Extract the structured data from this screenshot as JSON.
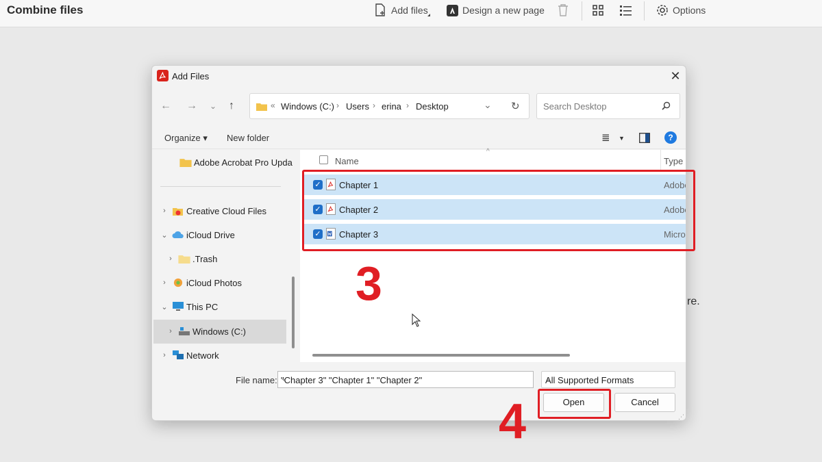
{
  "app": {
    "title": "Combine files",
    "toolbar": {
      "add_files": "Add files",
      "design_page": "Design a new page",
      "options": "Options"
    },
    "background_text": "re."
  },
  "dialog": {
    "title": "Add Files",
    "breadcrumb": [
      "Windows (C:)",
      "Users",
      "erina",
      "Desktop"
    ],
    "breadcrumb_prefix": "«",
    "search_placeholder": "Search Desktop",
    "commands": {
      "organize": "Organize ▾",
      "new_folder": "New folder",
      "help": "?"
    },
    "sidebar": [
      {
        "label": "Adobe Acrobat Pro Upda",
        "icon": "folder-icon",
        "expander": ""
      },
      {
        "label": "Creative Cloud Files",
        "icon": "creative-cloud-icon",
        "expander": "›"
      },
      {
        "label": "iCloud Drive",
        "icon": "cloud-icon",
        "expander": "⌄"
      },
      {
        "label": ".Trash",
        "icon": "folder-icon",
        "expander": "›"
      },
      {
        "label": "iCloud Photos",
        "icon": "photos-icon",
        "expander": "›"
      },
      {
        "label": "This PC",
        "icon": "monitor-icon",
        "expander": "⌄"
      },
      {
        "label": "Windows (C:)",
        "icon": "drive-icon",
        "expander": "›"
      },
      {
        "label": "Network",
        "icon": "network-icon",
        "expander": "›"
      }
    ],
    "columns": {
      "name": "Name",
      "type": "Type"
    },
    "files": [
      {
        "name": "Chapter 1",
        "type": "Adobe",
        "icon": "pdf-file-icon"
      },
      {
        "name": "Chapter 2",
        "type": "Adobe",
        "icon": "pdf-file-icon"
      },
      {
        "name": "Chapter 3",
        "type": "Microsoft",
        "icon": "word-file-icon"
      }
    ],
    "file_name_label": "File name:",
    "file_name_value": "\"Chapter 3\" \"Chapter 1\" \"Chapter 2\"",
    "filter_value": "All Supported Formats",
    "open_label": "Open",
    "cancel_label": "Cancel"
  },
  "annotations": {
    "step_files": "3",
    "step_open": "4"
  },
  "colors": {
    "highlight": "#e01e24",
    "selection": "#cce4f7",
    "accent": "#1f6fc8"
  }
}
